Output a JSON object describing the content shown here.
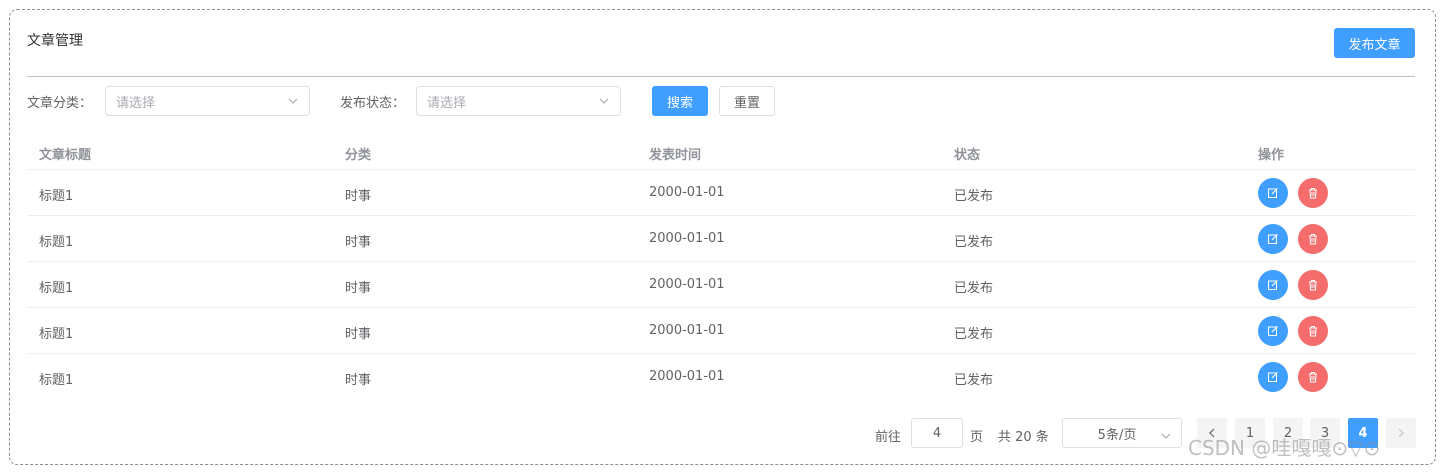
{
  "header": {
    "title": "文章管理",
    "publish_label": "发布文章"
  },
  "filters": {
    "category_label": "文章分类：",
    "category_placeholder": "请选择",
    "status_label": "发布状态：",
    "status_placeholder": "请选择",
    "search_label": "搜索",
    "reset_label": "重置"
  },
  "table": {
    "columns": [
      "文章标题",
      "分类",
      "发表时间",
      "状态",
      "操作"
    ],
    "rows": [
      {
        "title": "标题1",
        "category": "时事",
        "date": "2000-01-01",
        "status": "已发布"
      },
      {
        "title": "标题1",
        "category": "时事",
        "date": "2000-01-01",
        "status": "已发布"
      },
      {
        "title": "标题1",
        "category": "时事",
        "date": "2000-01-01",
        "status": "已发布"
      },
      {
        "title": "标题1",
        "category": "时事",
        "date": "2000-01-01",
        "status": "已发布"
      },
      {
        "title": "标题1",
        "category": "时事",
        "date": "2000-01-01",
        "status": "已发布"
      }
    ]
  },
  "pagination": {
    "goto_prefix": "前往",
    "goto_value": "4",
    "goto_suffix": "页",
    "total_text": "共 20 条",
    "page_size": "5条/页",
    "pages": [
      "1",
      "2",
      "3",
      "4"
    ],
    "current_page": "4"
  },
  "watermark": "CSDN @哇嘎嘎⊙▽⊙",
  "colors": {
    "primary": "#409eff",
    "danger": "#f56c6c",
    "border": "#dcdfe6"
  }
}
